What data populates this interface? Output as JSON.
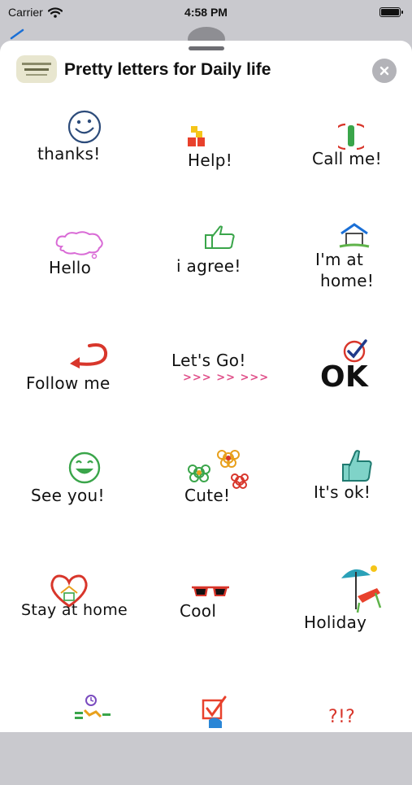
{
  "status_bar": {
    "carrier": "Carrier",
    "time": "4:58 PM"
  },
  "sheet": {
    "title": "Pretty letters for Daily life",
    "icon_caption": "pretty letters for Daily life"
  },
  "stickers": [
    {
      "caption": "thanks!",
      "icon": "smiley-icon"
    },
    {
      "caption": "Help!",
      "icon": "blocks-icon"
    },
    {
      "caption": "Call me!",
      "icon": "phone-icon"
    },
    {
      "caption": "Hello",
      "icon": "speech-cloud-icon"
    },
    {
      "caption": "i agree!",
      "icon": "thumbs-up-icon"
    },
    {
      "caption": "I'm at",
      "caption2": "home!",
      "icon": "house-icon"
    },
    {
      "caption": "Follow me",
      "icon": "curved-arrow-icon"
    },
    {
      "caption": "Let's Go!",
      "caption2": ">>> >> >>>",
      "icon": "arrows-icon"
    },
    {
      "caption": "OK",
      "icon": "check-circle-icon"
    },
    {
      "caption": "See you!",
      "icon": "smiley-icon"
    },
    {
      "caption": "Cute!",
      "icon": "flowers-icon"
    },
    {
      "caption": "It's ok!",
      "icon": "thumbs-up-icon"
    },
    {
      "caption": "Stay at home",
      "icon": "heart-house-icon"
    },
    {
      "caption": "Cool",
      "icon": "sunglasses-icon"
    },
    {
      "caption": "Holiday",
      "icon": "beach-chair-icon"
    },
    {
      "caption": "",
      "icon": "clock-person-icon"
    },
    {
      "caption": "",
      "icon": "checkbox-icon"
    },
    {
      "caption": "?!?",
      "icon": "question-marks-icon"
    }
  ],
  "colors": {
    "backdrop": "#c9c9ce",
    "sheet": "#ffffff",
    "close_button": "#b3b3b8",
    "accent_blue": "#1a6fd6"
  }
}
